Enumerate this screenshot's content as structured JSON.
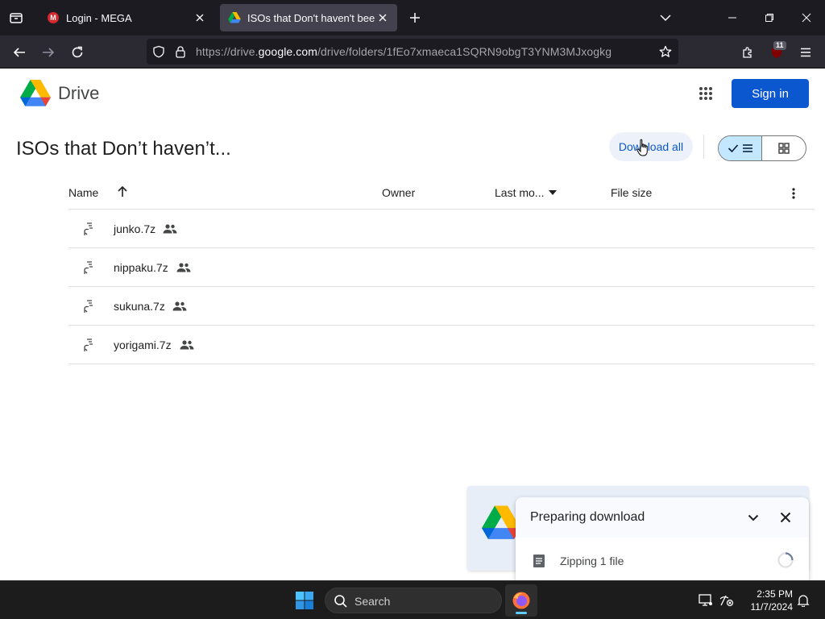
{
  "browser": {
    "tabs": [
      {
        "title": "Login - MEGA",
        "favicon": "mega-icon"
      },
      {
        "title": "ISOs that Don't haven't been up",
        "favicon": "google-drive-icon"
      }
    ],
    "url_prefix": "https://drive.",
    "url_domain": "google.com",
    "url_path": "/drive/folders/1fEo7xmaeca1SQRN9obgT3YNM3MJxogkg",
    "extension_badge": "11"
  },
  "drive": {
    "app_name": "Drive",
    "sign_in_label": "Sign in",
    "folder_title": "ISOs that Don’t haven’t...",
    "download_all_label": "Download all",
    "columns": {
      "name": "Name",
      "owner": "Owner",
      "last_modified": "Last mo...",
      "file_size": "File size"
    },
    "files": [
      {
        "name": "junko.7z"
      },
      {
        "name": "nippaku.7z"
      },
      {
        "name": "sukuna.7z"
      },
      {
        "name": "yorigami.7z"
      }
    ]
  },
  "download_panel": {
    "title": "Preparing download",
    "status": "Zipping 1 file"
  },
  "taskbar": {
    "search_label": "Search",
    "time": "2:35 PM",
    "date": "11/7/2024"
  },
  "colors": {
    "brand_blue": "#0b57d0",
    "chrome_dark": "#1c1b22",
    "tab_active": "#42414d"
  }
}
